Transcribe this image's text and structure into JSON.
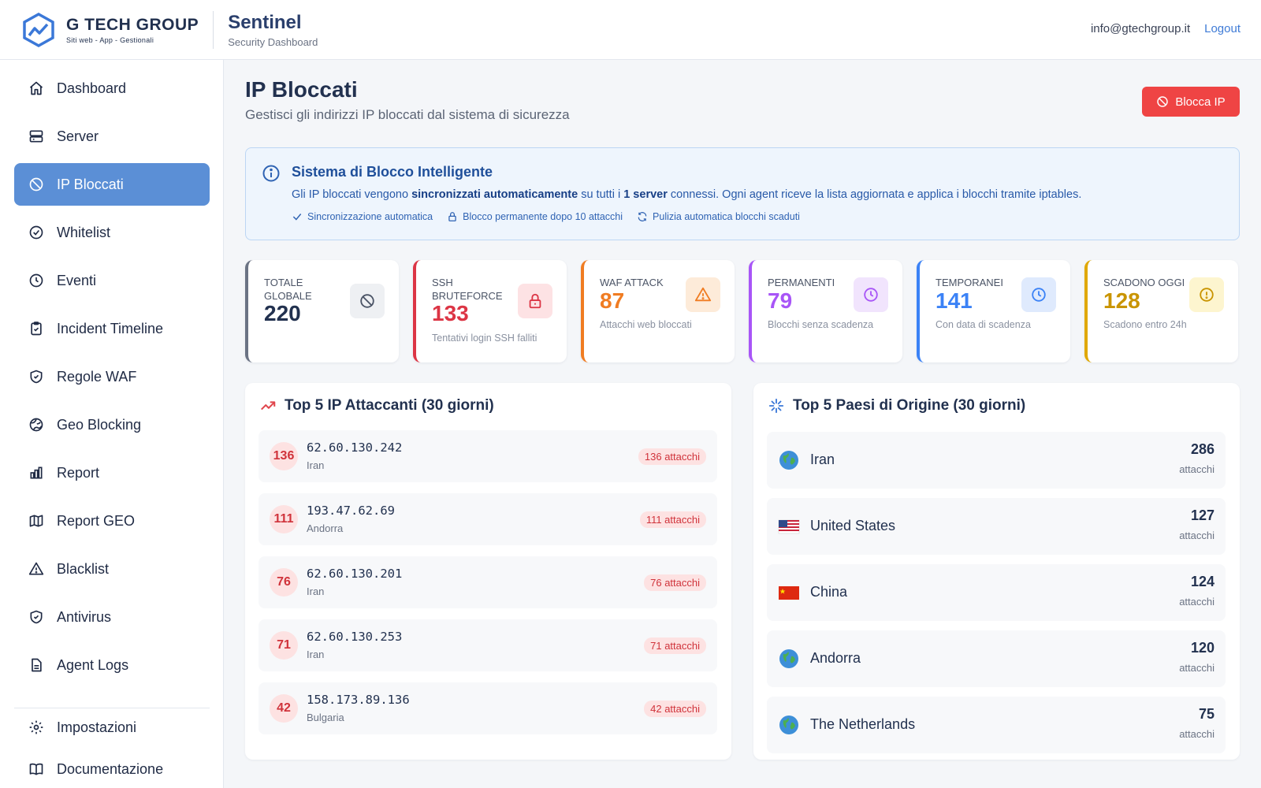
{
  "brand": {
    "company": "G TECH GROUP",
    "tagline": "Siti web - App - Gestionali",
    "app_name": "Sentinel",
    "app_subtitle": "Security Dashboard"
  },
  "header": {
    "email": "info@gtechgroup.it",
    "logout_label": "Logout"
  },
  "sidebar": {
    "items": [
      {
        "label": "Dashboard",
        "icon": "home-icon"
      },
      {
        "label": "Server",
        "icon": "server-icon"
      },
      {
        "label": "IP Bloccati",
        "icon": "ban-icon",
        "active": true
      },
      {
        "label": "Whitelist",
        "icon": "check-circle-icon"
      },
      {
        "label": "Eventi",
        "icon": "clock-icon"
      },
      {
        "label": "Incident Timeline",
        "icon": "clipboard-icon"
      },
      {
        "label": "Regole WAF",
        "icon": "shield-check-icon"
      },
      {
        "label": "Geo Blocking",
        "icon": "globe-icon"
      },
      {
        "label": "Report",
        "icon": "chart-icon"
      },
      {
        "label": "Report GEO",
        "icon": "map-icon"
      },
      {
        "label": "Blacklist",
        "icon": "warning-icon"
      },
      {
        "label": "Antivirus",
        "icon": "shield-check-icon"
      },
      {
        "label": "Agent Logs",
        "icon": "document-icon"
      }
    ],
    "bottom_items": [
      {
        "label": "Impostazioni",
        "icon": "gear-icon"
      },
      {
        "label": "Documentazione",
        "icon": "book-icon"
      }
    ]
  },
  "page": {
    "title": "IP Bloccati",
    "subtitle": "Gestisci gli indirizzi IP bloccati dal sistema di sicurezza",
    "block_button": "Blocca IP"
  },
  "info": {
    "title": "Sistema di Blocco Intelligente",
    "text_pre": "Gli IP bloccati vengono ",
    "text_bold1": "sincronizzati automaticamente",
    "text_mid": " su tutti i ",
    "text_bold2": "1 server",
    "text_post": " connessi. Ogni agent riceve la lista aggiornata e applica i blocchi tramite iptables.",
    "features": [
      "Sincronizzazione automatica",
      "Blocco permanente dopo 10 attacchi",
      "Pulizia automatica blocchi scaduti"
    ]
  },
  "stats": [
    {
      "label": "TOTALE GLOBALE",
      "value": "220",
      "note": "",
      "color": "#6b7384",
      "icon": "ban-icon"
    },
    {
      "label": "SSH BRUTEFORCE",
      "value": "133",
      "note": "Tentativi login SSH falliti",
      "color": "#dc3545",
      "icon": "lock-icon"
    },
    {
      "label": "WAF ATTACK",
      "value": "87",
      "note": "Attacchi web bloccati",
      "color": "#f07c22",
      "icon": "warning-icon"
    },
    {
      "label": "PERMANENTI",
      "value": "79",
      "note": "Blocchi senza scadenza",
      "color": "#a855f7",
      "icon": "clock-icon"
    },
    {
      "label": "TEMPORANEI",
      "value": "141",
      "note": "Con data di scadenza",
      "color": "#3b82f6",
      "icon": "clock-icon"
    },
    {
      "label": "SCADONO OGGI",
      "value": "128",
      "note": "Scadono entro 24h",
      "color": "#e0a800",
      "icon": "alert-circle-icon"
    }
  ],
  "top_ips": {
    "title": "Top 5 IP Attaccanti (30 giorni)",
    "rows": [
      {
        "rank": "136",
        "ip": "62.60.130.242",
        "country": "Iran",
        "badge": "136 attacchi"
      },
      {
        "rank": "111",
        "ip": "193.47.62.69",
        "country": "Andorra",
        "badge": "111 attacchi"
      },
      {
        "rank": "76",
        "ip": "62.60.130.201",
        "country": "Iran",
        "badge": "76 attacchi"
      },
      {
        "rank": "71",
        "ip": "62.60.130.253",
        "country": "Iran",
        "badge": "71 attacchi"
      },
      {
        "rank": "42",
        "ip": "158.173.89.136",
        "country": "Bulgaria",
        "badge": "42 attacchi"
      }
    ]
  },
  "top_countries": {
    "title": "Top 5 Paesi di Origine (30 giorni)",
    "rows": [
      {
        "name": "Iran",
        "count": "286",
        "unit": "attacchi",
        "flag": "globe"
      },
      {
        "name": "United States",
        "count": "127",
        "unit": "attacchi",
        "flag": "us"
      },
      {
        "name": "China",
        "count": "124",
        "unit": "attacchi",
        "flag": "cn"
      },
      {
        "name": "Andorra",
        "count": "120",
        "unit": "attacchi",
        "flag": "globe"
      },
      {
        "name": "The Netherlands",
        "count": "75",
        "unit": "attacchi",
        "flag": "globe"
      }
    ]
  }
}
